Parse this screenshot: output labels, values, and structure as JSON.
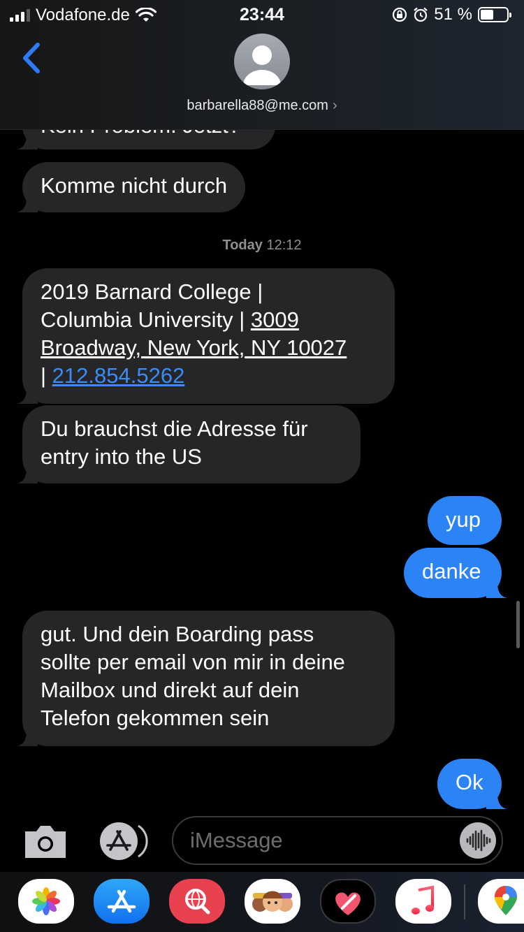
{
  "status_bar": {
    "carrier": "Vodafone.de",
    "time": "23:44",
    "battery_percent": "51 %",
    "battery_level": 0.51,
    "icons": [
      "signal-icon",
      "wifi-icon",
      "orientation-lock-icon",
      "alarm-icon",
      "battery-icon"
    ]
  },
  "header": {
    "contact": "barbarella88@me.com",
    "back_icon": "chevron-left-icon"
  },
  "messages": {
    "m0": "Kein Problem. Jetzt?",
    "m1": "Komme nicht durch",
    "timestamp_day": "Today",
    "timestamp_time": "12:12",
    "m2_part1": "2019 Barnard College |",
    "m2_part2": "Columbia University | ",
    "m2_addr1": "3009",
    "m2_addr2": "Broadway, New York, NY 10027",
    "m2_pipe": "| ",
    "m2_phone": "212.854.5262",
    "m3_line1": "Du brauchst die Adresse für",
    "m3_line2": "entry into the US",
    "m4": "yup",
    "m5": "danke",
    "m6_line1": "gut. Und dein Boarding pass",
    "m6_line2": "sollte per email von mir in deine",
    "m6_line3": "Mailbox und direkt auf dein",
    "m6_line4": "Telefon gekommen sein",
    "m7": "Ok"
  },
  "input": {
    "placeholder": "iMessage"
  },
  "colors": {
    "sent_bubble": "#2b83f6",
    "received_bubble": "#262628",
    "link": "#3b8cf5",
    "accent": "#2f7bf5"
  },
  "app_drawer": {
    "apps": [
      "photos-icon",
      "app-store-icon",
      "web-search-icon",
      "memoji-icon",
      "digital-touch-icon",
      "music-icon",
      "google-maps-icon"
    ]
  }
}
